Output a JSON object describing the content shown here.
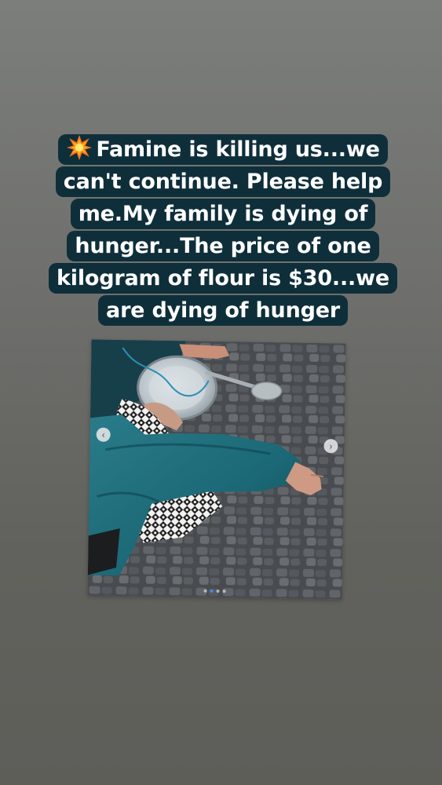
{
  "story": {
    "caption": "Famine is killing us...we can't continue. Please help me.My family is dying of hunger...The price of one kilogram of flour is $30...we are dying of hunger",
    "caption_icon": "collision-icon",
    "caption_bg": "#0e2e3a",
    "caption_color": "#ffffff"
  },
  "post": {
    "image_description_icon": "photo",
    "carousel": {
      "prev_icon": "chevron-left-icon",
      "next_icon": "chevron-right-icon",
      "total_slides": 4,
      "active_slide": 2
    }
  }
}
